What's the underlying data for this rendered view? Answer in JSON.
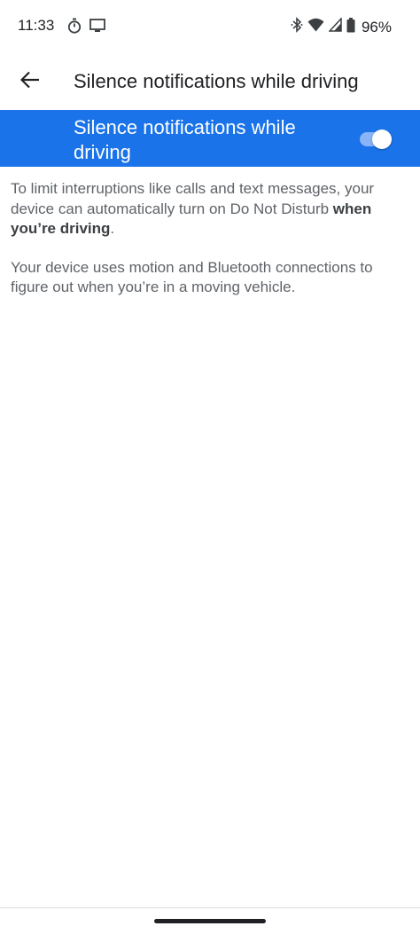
{
  "status_bar": {
    "time": "11:33",
    "battery": "96%",
    "icons": [
      "timer-icon",
      "cast-icon",
      "bluetooth-icon",
      "wifi-icon",
      "signal-icon",
      "battery-icon"
    ]
  },
  "app_bar": {
    "title": "Silence notifications while driving",
    "back_icon": "arrow-back-icon"
  },
  "toggle": {
    "label": "Silence notifications while driving",
    "checked": true,
    "accent_color": "#1a73e8"
  },
  "description": {
    "paragraph1_part1": "To limit interruptions like calls and text messages, your device can automatically turn on Do Not Disturb ",
    "paragraph1_bold": "when you’re driving",
    "paragraph1_part2": ".",
    "paragraph2": "Your device uses motion and Bluetooth connections to figure out when you’re in a moving vehicle."
  }
}
